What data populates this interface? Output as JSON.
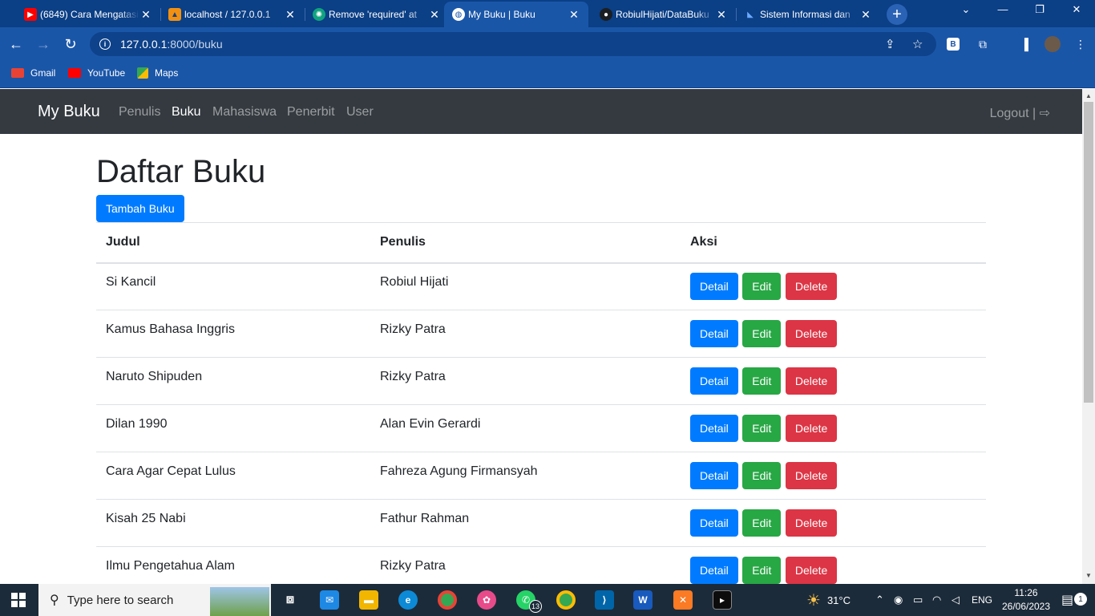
{
  "browser": {
    "tabs": [
      {
        "title": "(6849) Cara Mengatasi",
        "icon": "youtube-icon",
        "active": false
      },
      {
        "title": "localhost / 127.0.0.1",
        "icon": "phpmyadmin-icon",
        "active": false
      },
      {
        "title": "Remove 'required' at",
        "icon": "chatgpt-icon",
        "active": false
      },
      {
        "title": "My Buku | Buku",
        "icon": "globe-icon",
        "active": true
      },
      {
        "title": "RobiulHijati/DataBuku",
        "icon": "github-icon",
        "active": false
      },
      {
        "title": "Sistem Informasi dan",
        "icon": "app-icon",
        "active": false
      }
    ],
    "url_host": "127.0.0.1",
    "url_path": ":8000/buku",
    "bookmarks": [
      {
        "label": "Gmail",
        "icon": "gmail-icon"
      },
      {
        "label": "YouTube",
        "icon": "youtube-icon"
      },
      {
        "label": "Maps",
        "icon": "maps-icon"
      }
    ],
    "profile_badge": "B"
  },
  "app": {
    "brand": "My Buku",
    "nav": [
      {
        "label": "Penulis",
        "active": false
      },
      {
        "label": "Buku",
        "active": true
      },
      {
        "label": "Mahasiswa",
        "active": false
      },
      {
        "label": "Penerbit",
        "active": false
      },
      {
        "label": "User",
        "active": false
      }
    ],
    "logout_label": "Logout |",
    "page_title": "Daftar Buku",
    "add_button": "Tambah Buku",
    "table": {
      "headers": [
        "Judul",
        "Penulis",
        "Aksi"
      ],
      "actions": {
        "detail": "Detail",
        "edit": "Edit",
        "delete": "Delete"
      },
      "rows": [
        {
          "judul": "Si Kancil",
          "penulis": "Robiul Hijati"
        },
        {
          "judul": "Kamus Bahasa Inggris",
          "penulis": "Rizky Patra"
        },
        {
          "judul": "Naruto Shipuden",
          "penulis": "Rizky Patra"
        },
        {
          "judul": "Dilan 1990",
          "penulis": "Alan Evin Gerardi"
        },
        {
          "judul": "Cara Agar Cepat Lulus",
          "penulis": "Fahreza Agung Firmansyah"
        },
        {
          "judul": "Kisah 25 Nabi",
          "penulis": "Fathur Rahman"
        },
        {
          "judul": "Ilmu Pengetahua Alam",
          "penulis": "Rizky Patra"
        }
      ]
    }
  },
  "taskbar": {
    "search_placeholder": "Type here to search",
    "whatsapp_badge": "13",
    "weather": "31°C",
    "language": "ENG",
    "time": "11:26",
    "date": "26/06/2023",
    "notifications": "1"
  },
  "colors": {
    "navbar": "#343a40",
    "primary": "#007bff",
    "success": "#28a745",
    "danger": "#dc3545"
  }
}
